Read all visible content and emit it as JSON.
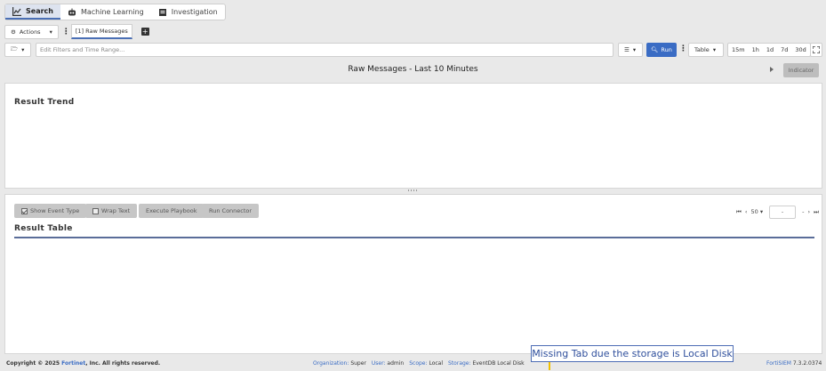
{
  "top_tabs": [
    {
      "label": "Search",
      "icon": "chart-icon",
      "active": true
    },
    {
      "label": "Machine Learning",
      "icon": "robot-icon",
      "active": false
    },
    {
      "label": "Investigation",
      "icon": "investigation-icon",
      "active": false
    }
  ],
  "toolbar": {
    "actions_label": "Actions",
    "raw_tab_label": "[1] Raw Messages"
  },
  "filter": {
    "placeholder": "Edit Filters and Time Range...",
    "run_label": "Run",
    "view_label": "Table",
    "ranges": [
      "15m",
      "1h",
      "1d",
      "7d",
      "30d"
    ]
  },
  "page_title": "Raw Messages - Last 10 Minutes",
  "indicator_label": "Indicator",
  "trend": {
    "heading": "Result Trend"
  },
  "result_table": {
    "heading": "Result Table",
    "show_event_type_label": "Show Event Type",
    "wrap_text_label": "Wrap Text",
    "execute_playbook_label": "Execute Playbook",
    "run_connector_label": "Run Connector",
    "page_size": "50",
    "page_input": "-",
    "page_sep": "-"
  },
  "footer": {
    "copyright_prefix": "Copyright © 2025 ",
    "company_link": "Fortinet",
    "copyright_suffix": ", Inc. All rights reserved.",
    "org_label": "Organization:",
    "org_value": "Super",
    "user_label": "User:",
    "user_value": "admin",
    "scope_label": "Scope:",
    "scope_value": "Local",
    "storage_label": "Storage:",
    "storage_value": "EventDB Local Disk",
    "product": "FortiSIEM",
    "version": "7.3.2.0374"
  },
  "callout": "Missing Tab due the storage is Local Disk",
  "colors": {
    "accent": "#3a6cc4",
    "tab_underline": "#4a6fb5"
  }
}
